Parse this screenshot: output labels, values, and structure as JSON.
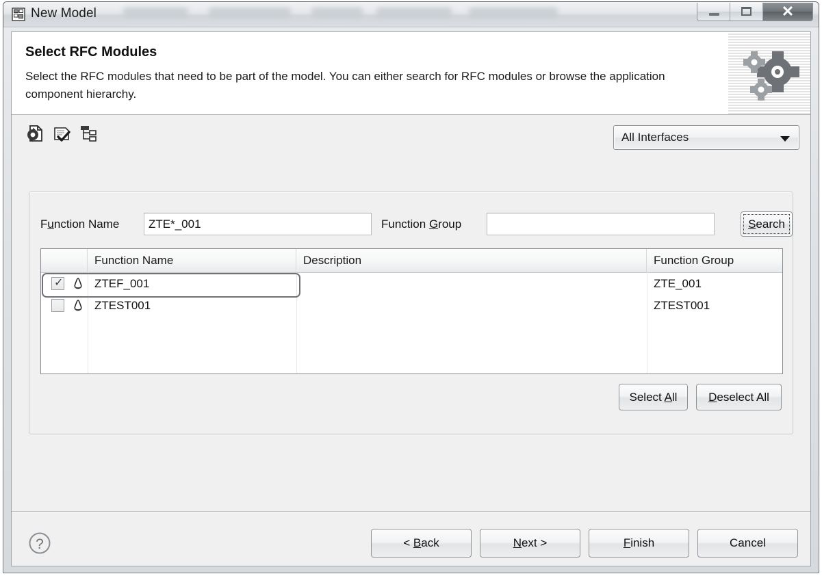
{
  "window": {
    "title": "New Model",
    "title_icon": "model-blocks-icon",
    "controls": {
      "minimize": "minimize-button",
      "maximize": "restore-button",
      "close": "close-button"
    }
  },
  "banner": {
    "title": "Select RFC Modules",
    "description": "Select the RFC modules that need to be part of the model. You can either search for RFC modules or browse the application component hierarchy.",
    "art": "gears-banner-graphic"
  },
  "toolbar": {
    "icons": [
      {
        "name": "refresh-icon"
      },
      {
        "name": "document-check-icon"
      },
      {
        "name": "hierarchy-tree-icon"
      }
    ],
    "filter_combo": {
      "value": "All Interfaces",
      "options": [
        "All Interfaces"
      ]
    }
  },
  "search": {
    "function_name": {
      "label_pre": "F",
      "label_mnemonic": "u",
      "label_post": "nction Name",
      "value": "ZTE*_001",
      "placeholder": ""
    },
    "function_group": {
      "label_pre": "Function ",
      "label_mnemonic": "G",
      "label_post": "roup",
      "value": "",
      "placeholder": ""
    },
    "search_button": {
      "label_pre": "",
      "label_mnemonic": "S",
      "label_post": "earch"
    }
  },
  "table": {
    "columns": [
      "",
      "Function Name",
      "Description",
      "Function Group"
    ],
    "rows": [
      {
        "checked": true,
        "check_glyph": "✓",
        "icon": "rfc-module-icon",
        "function_name": "ZTEF_001",
        "description": "",
        "function_group": "ZTE_001",
        "focused": true
      },
      {
        "checked": false,
        "check_glyph": "",
        "icon": "rfc-module-icon",
        "function_name": "ZTEST001",
        "description": "",
        "function_group": "ZTEST001",
        "focused": false
      }
    ]
  },
  "panel_buttons": {
    "select_all": {
      "pre": "Select ",
      "mnemonic": "A",
      "post": "ll"
    },
    "deselect_all": {
      "pre": "",
      "mnemonic": "D",
      "post": "eselect All"
    }
  },
  "footer": {
    "help": "?",
    "back": {
      "pre": "< ",
      "mnemonic": "B",
      "post": "ack"
    },
    "next": {
      "pre": "",
      "mnemonic": "N",
      "post": "ext >"
    },
    "finish": {
      "pre": "",
      "mnemonic": "F",
      "post": "inish"
    },
    "cancel": {
      "pre": "Cancel",
      "mnemonic": "",
      "post": ""
    }
  },
  "colors": {
    "dialog_bg": "#f0f0f0",
    "banner_bg": "#ffffff",
    "text": "#101010",
    "border": "#8e9398",
    "titlebar_top": "#f2f3f5"
  }
}
